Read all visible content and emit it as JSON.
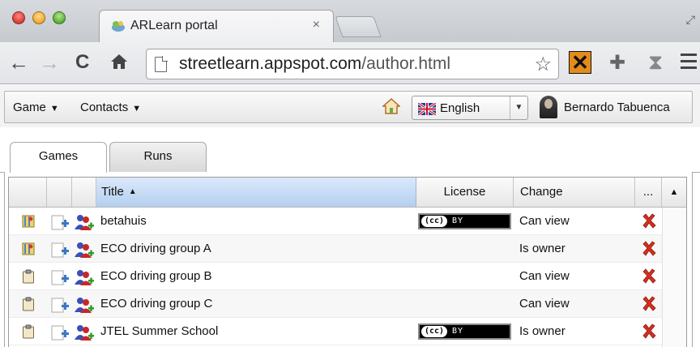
{
  "browser": {
    "tab_title": "ARLearn portal",
    "tab_close": "×",
    "url_host": "streetlearn.appspot.com",
    "url_path": "/author.html",
    "star": "☆",
    "icons": [
      "back-arrow-icon",
      "forward-arrow-icon",
      "reload-icon",
      "home-icon",
      "page-icon",
      "bookmark-star-icon",
      "extension-x-icon",
      "puzzle-icon",
      "hourglass-icon",
      "menu-icon"
    ]
  },
  "appbar": {
    "game_menu": "Game",
    "contacts_menu": "Contacts",
    "language": "English",
    "user_name": "Bernardo Tabuenca"
  },
  "tabs": {
    "games": "Games",
    "runs": "Runs"
  },
  "grid": {
    "headers": {
      "title": "Title",
      "license": "License",
      "change": "Change",
      "more": "..."
    },
    "rows": [
      {
        "type": "map",
        "title": "betahuis",
        "license": "cc-by",
        "change": "Can view"
      },
      {
        "type": "map",
        "title": "ECO driving group A",
        "license": "",
        "change": "Is owner"
      },
      {
        "type": "clipboard",
        "title": "ECO driving group B",
        "license": "",
        "change": "Can view"
      },
      {
        "type": "clipboard",
        "title": "ECO driving group C",
        "license": "",
        "change": "Can view"
      },
      {
        "type": "clipboard",
        "title": "JTEL Summer School",
        "license": "cc-by",
        "change": "Is owner"
      }
    ],
    "cc_label": "cc",
    "by_label": "BY"
  },
  "colors": {
    "header_selected": "#b3cfef",
    "delete_red": "#d32f1e",
    "extension_orange": "#e58b1a"
  }
}
